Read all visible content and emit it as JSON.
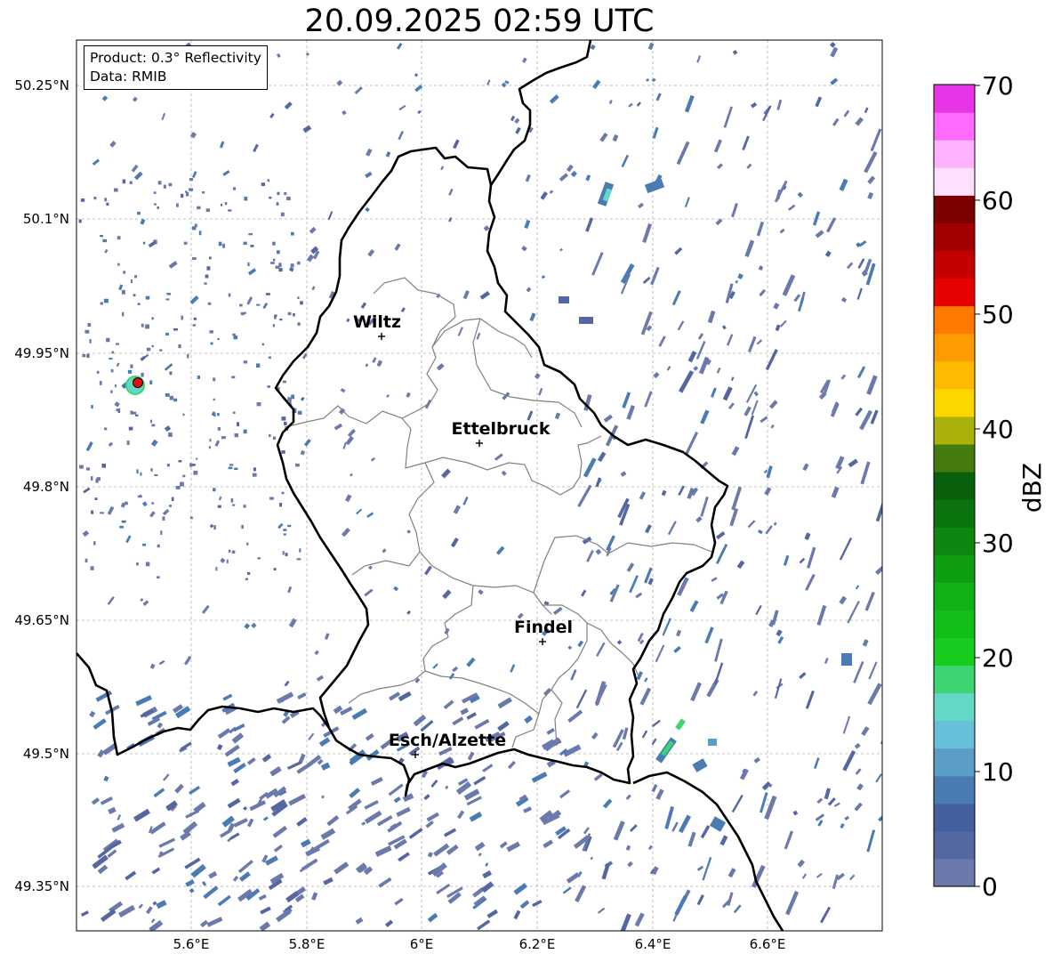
{
  "title": "20.09.2025 02:59 UTC",
  "info": {
    "product": "Product: 0.3° Reflectivity",
    "data": "Data: RMIB"
  },
  "lat_labels": [
    "50.25°N",
    "50.1°N",
    "49.95°N",
    "49.8°N",
    "49.65°N",
    "49.5°N",
    "49.35°N"
  ],
  "lon_labels": [
    "5.6°E",
    "5.8°E",
    "6°E",
    "6.2°E",
    "6.4°E",
    "6.6°E"
  ],
  "cities": [
    {
      "name": "Wiltz"
    },
    {
      "name": "Ettelbruck"
    },
    {
      "name": "Findel"
    },
    {
      "name": "Esch/Alzette"
    }
  ],
  "colorbar": {
    "label": "dBZ",
    "ticks": [
      "0",
      "10",
      "20",
      "30",
      "40",
      "50",
      "60",
      "70"
    ],
    "colors": [
      "#6b7aab",
      "#5567a0",
      "#4560a0",
      "#4a7bb3",
      "#5a9ec6",
      "#67c0d8",
      "#63d8c5",
      "#3ed472",
      "#18cc1f",
      "#12be18",
      "#10b216",
      "#0f9e12",
      "#0d8710",
      "#0b730d",
      "#09600b",
      "#447a0e",
      "#a9b10a",
      "#fdd600",
      "#fdbb00",
      "#fd9c00",
      "#ff7a00",
      "#e70000",
      "#c50000",
      "#a20000",
      "#7b0000",
      "#ffe0ff",
      "#ffb3ff",
      "#ff6bff",
      "#e734e7"
    ]
  },
  "radar_site": {
    "color": "#dd1111"
  }
}
